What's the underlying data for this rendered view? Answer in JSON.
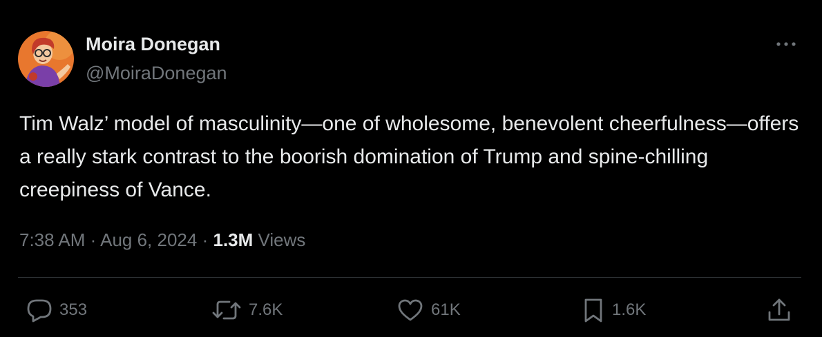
{
  "author": {
    "display_name": "Moira Donegan",
    "handle": "@MoiraDonegan"
  },
  "tweet": {
    "text": "Tim Walz’ model of masculinity—one of wholesome, benevolent cheerfulness—offers a really stark contrast to the boorish domination of Trump and spine-chilling creepiness of Vance."
  },
  "meta": {
    "time": "7:38 AM",
    "separator": "·",
    "date": "Aug 6, 2024",
    "views_count": "1.3M",
    "views_label": "Views"
  },
  "actions": {
    "replies": "353",
    "reposts": "7.6K",
    "likes": "61K",
    "bookmarks": "1.6K"
  },
  "icons": {
    "more": "more-horizontal-icon",
    "reply": "reply-bubble-icon",
    "repost": "repost-arrows-icon",
    "like": "heart-icon",
    "bookmark": "bookmark-icon",
    "share": "share-upload-icon"
  },
  "colors": {
    "background": "#000000",
    "primary_text": "#e7e9ea",
    "secondary_text": "#71767b",
    "divider": "#2f3336",
    "avatar_bg": "#e8772e"
  }
}
